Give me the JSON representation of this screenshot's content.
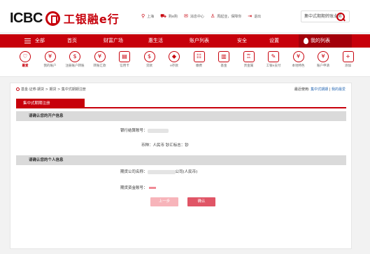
{
  "header": {
    "logo_en": "ICBC",
    "logo_cn": "工银融e行",
    "util": [
      {
        "icon": "location-icon",
        "glyph": "⚲",
        "label": "上海"
      },
      {
        "icon": "cart-icon",
        "glyph": "⛟",
        "label": "购e购"
      },
      {
        "icon": "mail-icon",
        "glyph": "✉",
        "label": "消息中心"
      },
      {
        "icon": "user-icon",
        "glyph": "♙",
        "label": "周起亚，保障你"
      },
      {
        "icon": "logout-icon",
        "glyph": "⇥",
        "label": "退出"
      }
    ],
    "search_value": "集中式期期转账业务"
  },
  "nav": {
    "items": [
      "全部",
      "首页",
      "财富广场",
      "惠生活",
      "账户列表",
      "安全",
      "设置"
    ],
    "my_list": "我的列表"
  },
  "icon_row": [
    {
      "name": "favorite-icon",
      "glyph": "♡",
      "label": "最爱",
      "active": true,
      "sq": false
    },
    {
      "name": "my-account-icon",
      "glyph": "¥",
      "label": "我的账户",
      "active": false,
      "sq": false
    },
    {
      "name": "register-account-icon",
      "glyph": "$",
      "label": "注册账户转账",
      "active": false,
      "sq": false
    },
    {
      "name": "transfer-icon",
      "glyph": "¥",
      "label": "转账汇款",
      "active": false,
      "sq": false
    },
    {
      "name": "credit-card-icon",
      "glyph": "▤",
      "label": "信用卡",
      "active": false,
      "sq": true
    },
    {
      "name": "loan-icon",
      "glyph": "$",
      "label": "贷款",
      "active": false,
      "sq": false
    },
    {
      "name": "e-deposit-icon",
      "glyph": "◆",
      "label": "e存款",
      "active": false,
      "sq": false
    },
    {
      "name": "payment-icon",
      "glyph": "☷",
      "label": "缴费",
      "active": false,
      "sq": true
    },
    {
      "name": "fund-icon",
      "glyph": "▥",
      "label": "基金",
      "active": false,
      "sq": true
    },
    {
      "name": "precious-metal-icon",
      "glyph": "♖",
      "label": "贵金属",
      "active": false,
      "sq": true
    },
    {
      "name": "work-card-icon",
      "glyph": "✎",
      "label": "工银e支付",
      "active": false,
      "sq": true
    },
    {
      "name": "forex-icon",
      "glyph": "¥",
      "label": "本地特色",
      "active": false,
      "sq": false
    },
    {
      "name": "account-apply-icon",
      "glyph": "¥",
      "label": "账户申请",
      "active": false,
      "sq": false
    },
    {
      "name": "add-icon",
      "glyph": "+",
      "label": "添加",
      "active": false,
      "sq": true
    }
  ],
  "breadcrumb": "基金·证券·期货 > 期货 > 集中式期期注册",
  "links": {
    "prefix": "最近使用:",
    "link1": "集中式期期",
    "link2": "我的最爱"
  },
  "tab": "集中式期期注册",
  "section1": {
    "title": "请确认您的开户信息",
    "account_label": "银行结算账号：",
    "currency_line": "币种：人民币   钞汇标志：钞"
  },
  "section2": {
    "title": "请确认您的个人信息",
    "company_label": "期货公司名称：",
    "company_suffix": "公司(人民币)",
    "futures_label": "期货资金账号："
  },
  "buttons": {
    "prev": "上一步",
    "confirm": "确认"
  }
}
